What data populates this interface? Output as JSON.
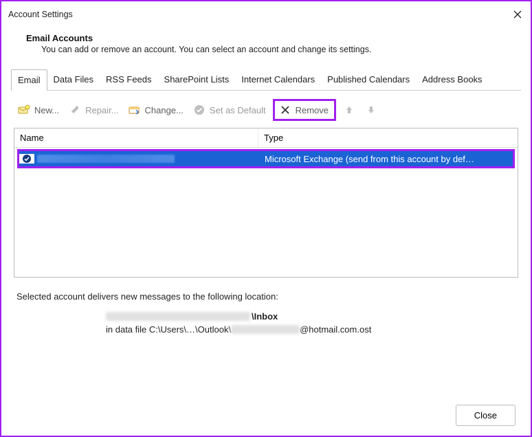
{
  "window": {
    "title": "Account Settings"
  },
  "header": {
    "title": "Email Accounts",
    "desc": "You can add or remove an account. You can select an account and change its settings."
  },
  "tabs": {
    "email": "Email",
    "datafiles": "Data Files",
    "rss": "RSS Feeds",
    "sharepoint": "SharePoint Lists",
    "icals": "Internet Calendars",
    "pubcals": "Published Calendars",
    "addrbooks": "Address Books"
  },
  "toolbar": {
    "new": "New...",
    "repair": "Repair...",
    "change": "Change...",
    "setdefault": "Set as Default",
    "remove": "Remove"
  },
  "table": {
    "col_name": "Name",
    "col_type": "Type",
    "rows": [
      {
        "type": "Microsoft Exchange (send from this account by def…"
      }
    ]
  },
  "delivery": {
    "line1": "Selected account delivers new messages to the following location:",
    "inbox_suffix": "\\Inbox",
    "datafile_prefix": "in data file C:\\Users\\…\\Outlook\\",
    "datafile_suffix": "@hotmail.com.ost"
  },
  "footer": {
    "close": "Close"
  }
}
